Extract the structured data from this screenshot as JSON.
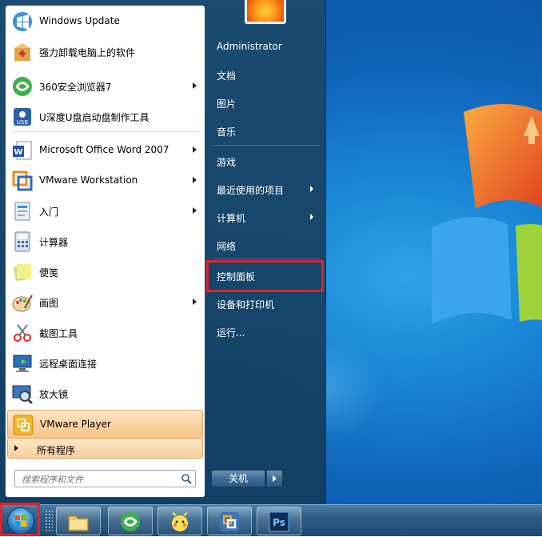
{
  "left_pane": {
    "pinned": [
      {
        "label": "Windows Update",
        "icon": "windows-update-icon",
        "arrow": false
      },
      {
        "label": "强力卸载电脑上的软件",
        "icon": "uninstall-box-icon",
        "arrow": false
      },
      {
        "label": "360安全浏览器7",
        "icon": "360-browser-icon",
        "arrow": true
      },
      {
        "label": "U深度U盘启动盘制作工具",
        "icon": "usb-tool-icon",
        "arrow": false
      }
    ],
    "recent": [
      {
        "label": "Microsoft Office Word 2007",
        "icon": "word-icon",
        "arrow": true
      },
      {
        "label": "VMware Workstation",
        "icon": "vmware-workstation-icon",
        "arrow": true
      },
      {
        "label": "入门",
        "icon": "getting-started-icon",
        "arrow": true
      },
      {
        "label": "计算器",
        "icon": "calculator-icon",
        "arrow": false
      },
      {
        "label": "便笺",
        "icon": "sticky-notes-icon",
        "arrow": false
      },
      {
        "label": "画图",
        "icon": "paint-icon",
        "arrow": true
      },
      {
        "label": "截图工具",
        "icon": "snipping-tool-icon",
        "arrow": false
      },
      {
        "label": "远程桌面连接",
        "icon": "remote-desktop-icon",
        "arrow": false
      },
      {
        "label": "放大镜",
        "icon": "magnifier-icon",
        "arrow": false
      },
      {
        "label": "VMware Player",
        "icon": "vmware-player-icon",
        "arrow": false
      }
    ],
    "all_programs": "所有程序",
    "search_placeholder": "搜索程序和文件"
  },
  "right_pane": {
    "items": [
      {
        "label": "Administrator",
        "arrow": false
      },
      {
        "label": "文档",
        "arrow": false
      },
      {
        "label": "图片",
        "arrow": false
      },
      {
        "label": "音乐",
        "arrow": false
      },
      {
        "label": "游戏",
        "arrow": false
      },
      {
        "label": "最近使用的项目",
        "arrow": true
      },
      {
        "label": "计算机",
        "arrow": true
      },
      {
        "label": "网络",
        "arrow": false
      },
      {
        "label": "控制面板",
        "arrow": false
      },
      {
        "label": "设备和打印机",
        "arrow": false
      },
      {
        "label": "运行...",
        "arrow": false
      }
    ],
    "shutdown_label": "关机"
  },
  "taskbar": {
    "apps": [
      {
        "icon": "file-explorer-icon"
      },
      {
        "icon": "360-browser-icon"
      },
      {
        "icon": "cartoon-app-icon"
      },
      {
        "icon": "vmware-icon"
      },
      {
        "icon": "photoshop-icon",
        "text": "Ps"
      }
    ]
  },
  "colors": {
    "highlight": "#e0232a",
    "menu_bg": "#1c4a6e",
    "selected_item": "#fbd3a3"
  }
}
